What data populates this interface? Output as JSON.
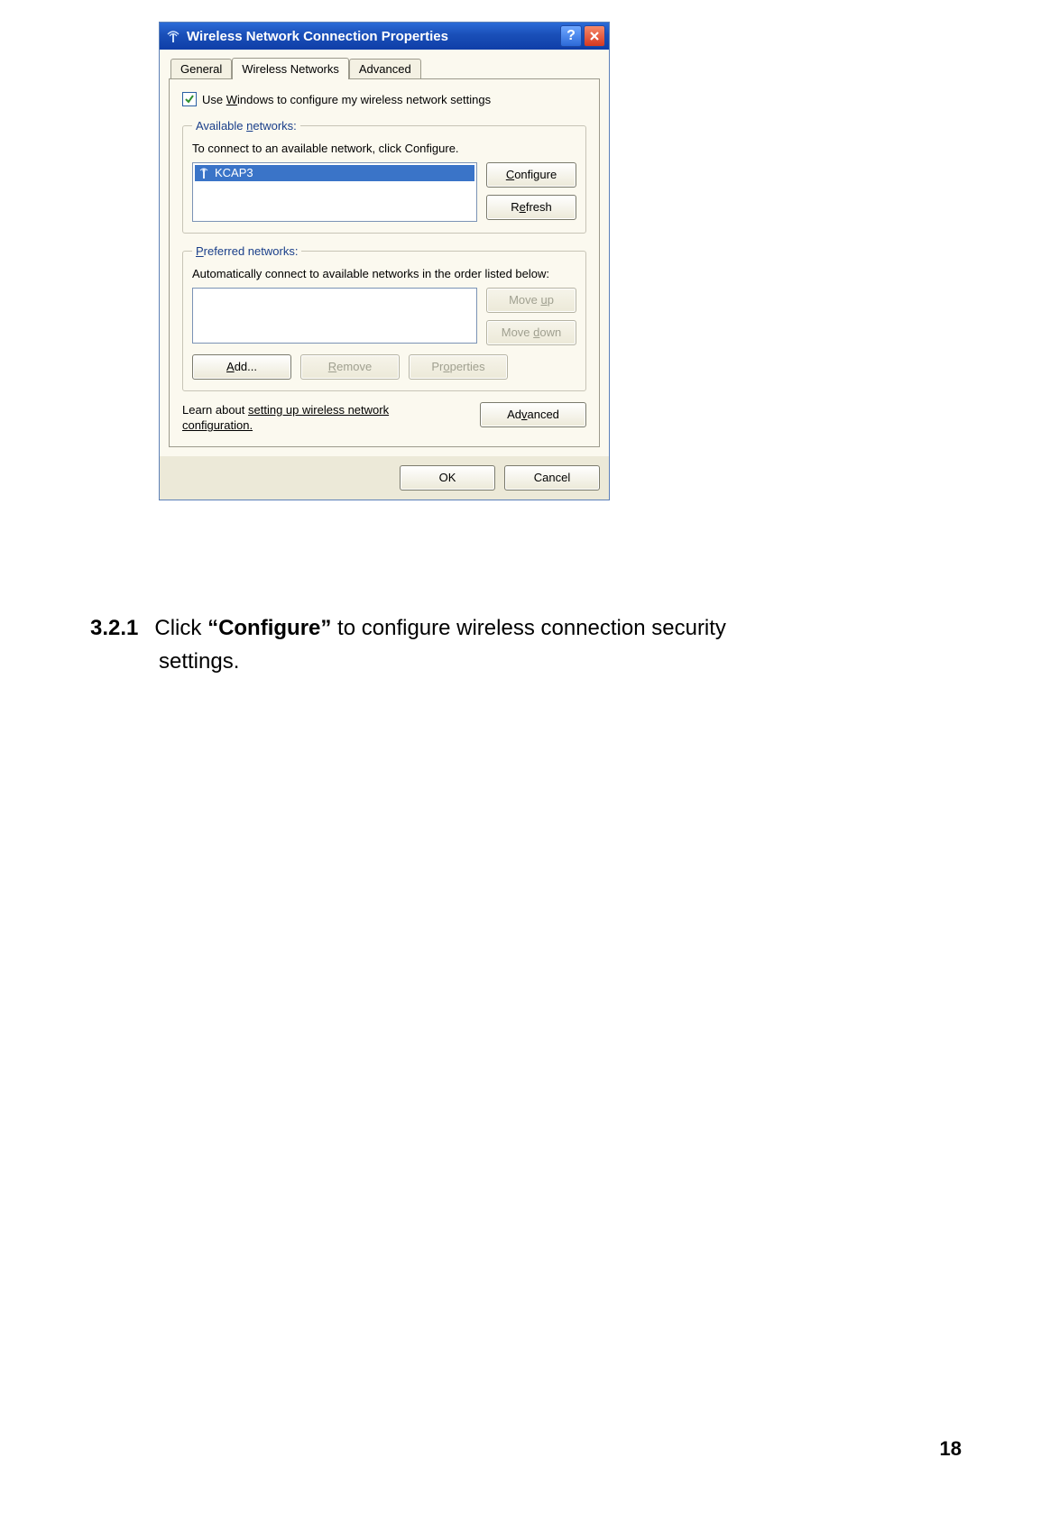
{
  "dialog": {
    "title": "Wireless Network Connection Properties",
    "tabs": {
      "general": "General",
      "wireless": "Wireless Networks",
      "advanced": "Advanced"
    },
    "use_windows_label_pre": "Use ",
    "use_windows_label_ul": "W",
    "use_windows_label_post": "indows to configure my wireless network settings",
    "available": {
      "legend_pre": "Available ",
      "legend_ul": "n",
      "legend_post": "etworks:",
      "help": "To connect to an available network, click Configure.",
      "items": [
        {
          "name": "KCAP3",
          "selected": true
        }
      ],
      "configure_ul": "C",
      "configure_post": "onfigure",
      "refresh_pre": "R",
      "refresh_ul": "e",
      "refresh_post": "fresh"
    },
    "preferred": {
      "legend_ul": "P",
      "legend_post": "referred networks:",
      "help": "Automatically connect to available networks in the order listed below:",
      "moveup_pre": "Move ",
      "moveup_ul": "u",
      "moveup_post": "p",
      "movedown_pre": "Move ",
      "movedown_ul": "d",
      "movedown_post": "own",
      "add_ul": "A",
      "add_post": "dd...",
      "remove_ul": "R",
      "remove_post": "emove",
      "properties_pre": "Pr",
      "properties_ul": "o",
      "properties_post": "perties"
    },
    "learn_pre": "Learn about ",
    "learn_link": "setting up wireless network configuration.",
    "advanced_btn_pre": "Ad",
    "advanced_btn_ul": "v",
    "advanced_btn_post": "anced",
    "ok": "OK",
    "cancel": "Cancel"
  },
  "instruction": {
    "number": "3.2.1",
    "pre": "Click ",
    "bold": "“Configure”",
    "post": " to configure wireless connection security",
    "line2": "settings."
  },
  "page_number": "18"
}
